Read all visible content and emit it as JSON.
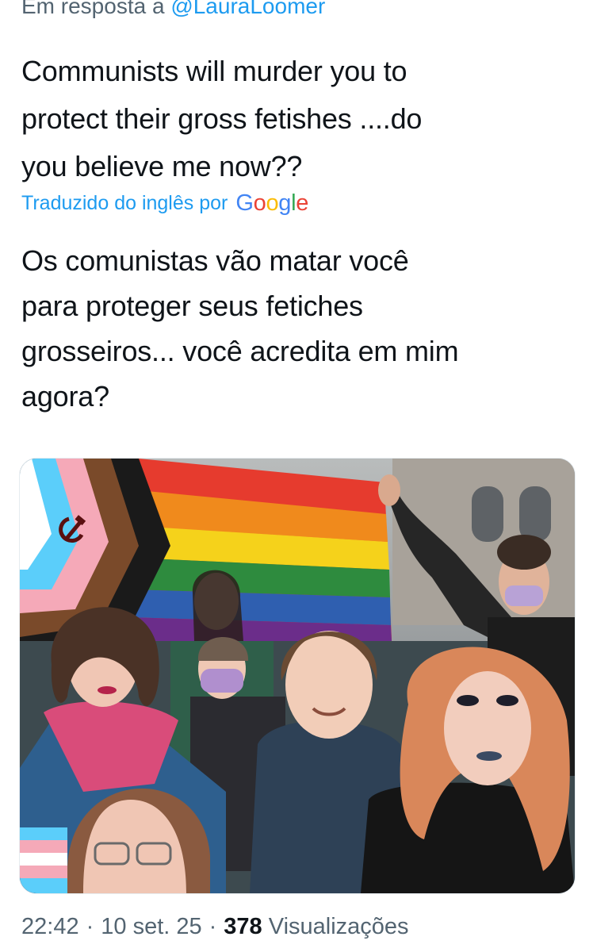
{
  "reply": {
    "prefix": "Em resposta a",
    "handle": "@LauraLoomer"
  },
  "tweet": {
    "text": "Communists will murder you to\nprotect their gross fetishes ....do\nyou believe me now??"
  },
  "translation": {
    "label": "Traduzido do inglês por",
    "provider": "Google",
    "text": "Os comunistas vão matar você\npara proteger seus fetiches\ngrosseiros... você acredita em mim\nagora?"
  },
  "meta": {
    "time": "22:42",
    "separator": "·",
    "date": "10 set. 25",
    "views_count": "378",
    "views_label": "Visualizações"
  },
  "colors": {
    "link_blue": "#1d9bf0",
    "secondary_text": "#536471",
    "google_blue": "#4285F4",
    "google_red": "#EA4335",
    "google_yellow": "#FBBC05",
    "google_green": "#34A853"
  },
  "image": {
    "icon": "hammer-and-sickle-icon"
  }
}
